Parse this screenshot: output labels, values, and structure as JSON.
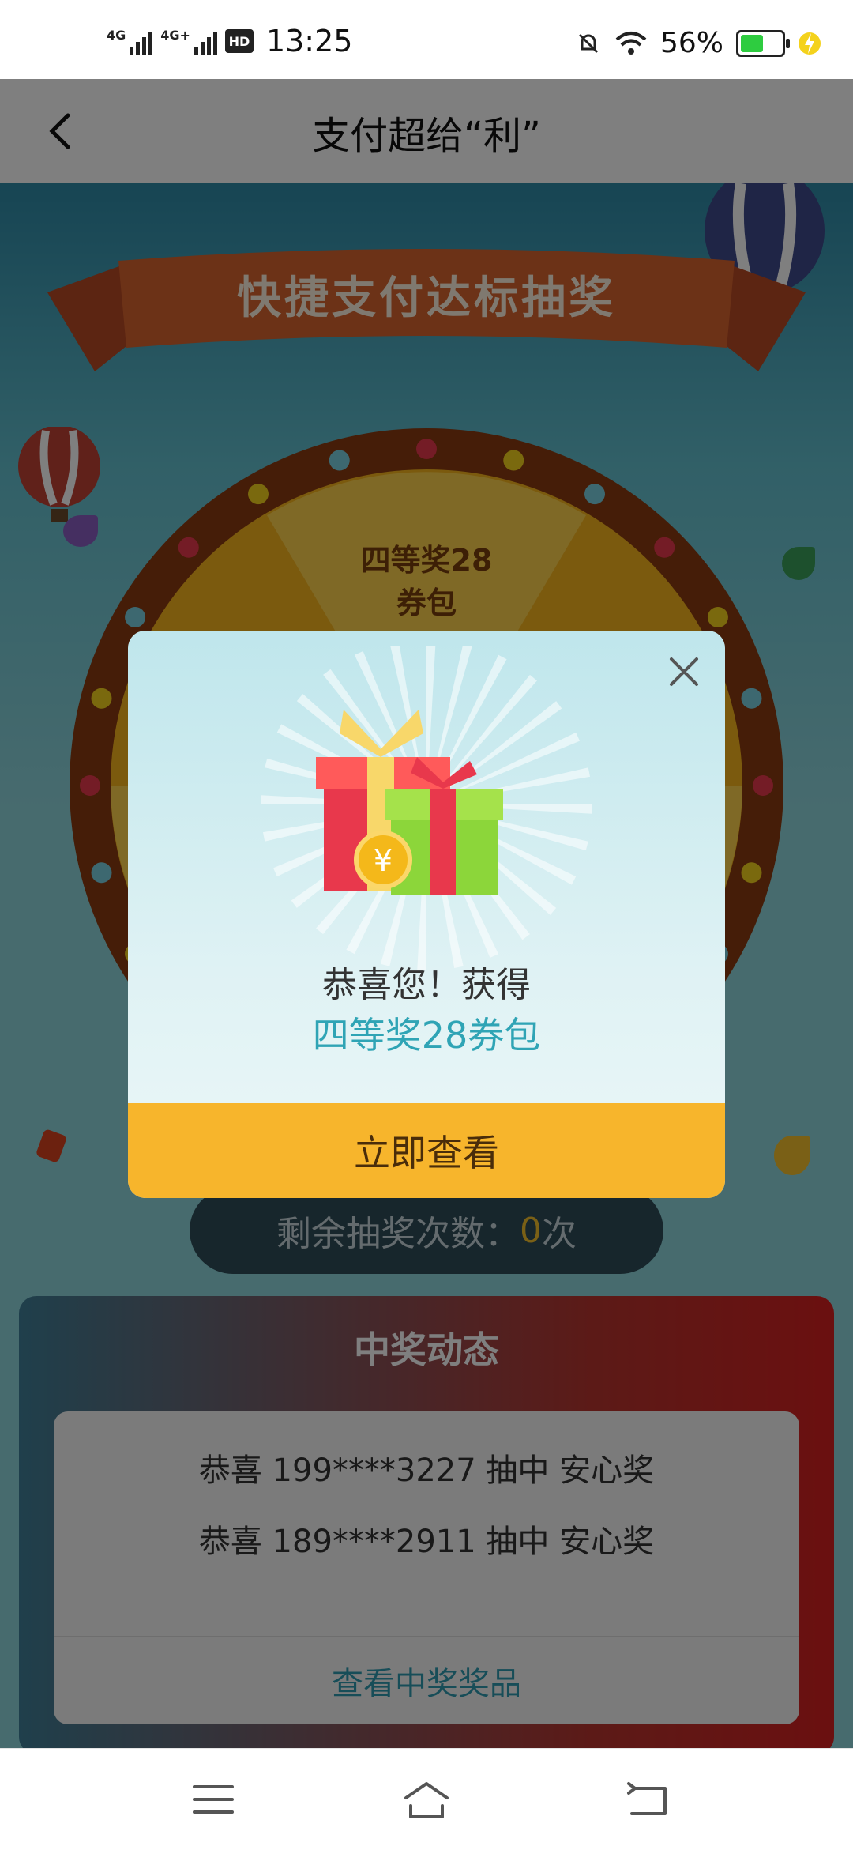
{
  "status_bar": {
    "network_1": "4G",
    "network_2": "4G+",
    "hd_badge": "HD",
    "time": "13:25",
    "battery_percent": "56%",
    "battery_level": 0.56,
    "battery_color": "#2ecc40",
    "icons": [
      "signal-icon",
      "signal-icon",
      "hd-icon",
      "mute-icon",
      "wifi-icon",
      "battery-icon",
      "charging-icon"
    ]
  },
  "header": {
    "back_icon": "chevron-left-icon",
    "title": "支付超给“利”"
  },
  "banner": {
    "title": "快捷支付达标抽奖"
  },
  "wheel": {
    "visible_sector_label": "四等奖28\n券包"
  },
  "remaining": {
    "prefix": "剩余抽奖次数：",
    "count": "0",
    "suffix": "次"
  },
  "winners": {
    "title": "中奖动态",
    "rows": [
      "恭喜 199****3227 抽中 安心奖",
      "恭喜 189****2911 抽中 安心奖"
    ],
    "view_link": "查看中奖奖品"
  },
  "modal": {
    "close_icon": "close-icon",
    "gift_icon": "gift-icon",
    "congrats": "恭喜您！获得",
    "prize": "四等奖28券包",
    "button": "立即查看",
    "button_color": "#f7b52c"
  },
  "bottom_nav": {
    "icons": [
      "menu-icon",
      "home-icon",
      "back-icon"
    ]
  }
}
